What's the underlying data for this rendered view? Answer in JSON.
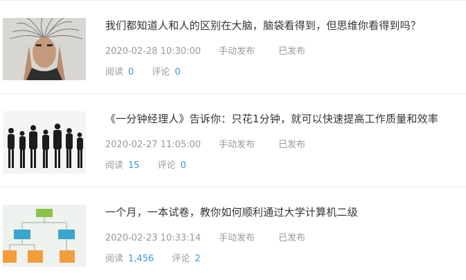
{
  "articles": [
    {
      "title": "我们都知道人和人的区别在大脑，脑袋看得到，但思维你看得到吗？",
      "date": "2020-02-28 10:30:00",
      "publish_mode": "手动发布",
      "status": "已发布",
      "read_label": "阅读",
      "read_count": "0",
      "comment_label": "评论",
      "comment_count": "0"
    },
    {
      "title": "《一分钟经理人》告诉你：只花1分钟，就可以快速提高工作质量和效率",
      "date": "2020-02-27 11:05:00",
      "publish_mode": "手动发布",
      "status": "已发布",
      "read_label": "阅读",
      "read_count": "15",
      "comment_label": "评论",
      "comment_count": "0"
    },
    {
      "title": "一个月，一本试卷，教你如何顺利通过大学计算机二级",
      "date": "2020-02-23 10:33:14",
      "publish_mode": "手动发布",
      "status": "已发布",
      "read_label": "阅读",
      "read_count": "1,456",
      "comment_label": "评论",
      "comment_count": "2"
    }
  ]
}
